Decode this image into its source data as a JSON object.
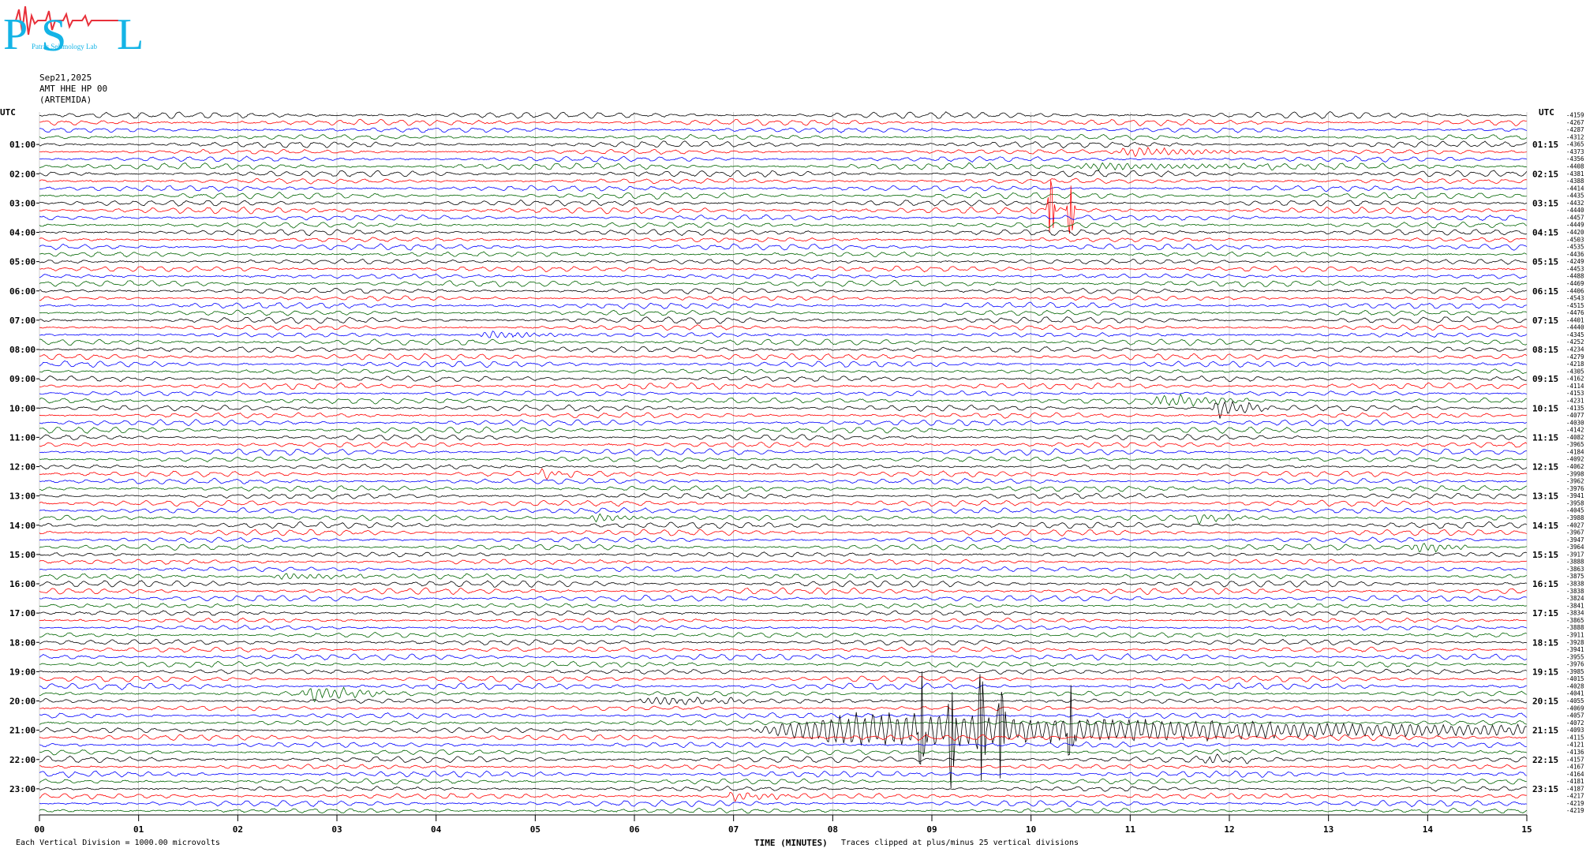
{
  "logo": {
    "text": "PSL",
    "subtitle": "Patras Seismology Lab",
    "colors": [
      "#14b4e6",
      "#e8303a"
    ]
  },
  "header": {
    "date": "Sep21,2025",
    "channel": "AMT HHE HP 00",
    "station": "(ARTEMIDA)"
  },
  "axis_labels": {
    "left_top": "UTC",
    "right_top": "UTC"
  },
  "footer": {
    "scale_text": "Each Vertical Division = 1000.00 microvolts",
    "xlabel": "TIME (MINUTES)",
    "clip_text": "Traces clipped at plus/minus 25 vertical divisions"
  },
  "chart_data": {
    "type": "line",
    "xlabel": "TIME (MINUTES)",
    "xlim": [
      0,
      15
    ],
    "x_ticks": [
      "00",
      "01",
      "02",
      "03",
      "04",
      "05",
      "06",
      "07",
      "08",
      "09",
      "10",
      "11",
      "12",
      "13",
      "14",
      "15"
    ],
    "left_hour_labels": [
      "01:00",
      "02:00",
      "03:00",
      "04:00",
      "05:00",
      "06:00",
      "07:00",
      "08:00",
      "09:00",
      "10:00",
      "11:00",
      "12:00",
      "13:00",
      "14:00",
      "15:00",
      "16:00",
      "17:00",
      "18:00",
      "19:00",
      "20:00",
      "21:00",
      "22:00",
      "23:00"
    ],
    "right_hour_labels": [
      "01:15",
      "02:15",
      "03:15",
      "04:15",
      "05:15",
      "06:15",
      "07:15",
      "08:15",
      "09:15",
      "10:15",
      "11:15",
      "12:15",
      "13:15",
      "14:15",
      "15:15",
      "16:15",
      "17:15",
      "18:15",
      "19:15",
      "20:15",
      "21:15",
      "22:15",
      "23:15"
    ],
    "trace_colors": [
      "#000000",
      "#ff0000",
      "#0000ff",
      "#006400"
    ],
    "traces_per_hour": 4,
    "trace_count": 96,
    "row_offsets": [
      -4159,
      -4267,
      -4287,
      -4312,
      -4365,
      -4373,
      -4356,
      -4408,
      -4381,
      -4388,
      -4414,
      -4435,
      -4432,
      -4440,
      -4457,
      -4449,
      -4420,
      -4503,
      -4535,
      -4436,
      -4249,
      -4453,
      -4488,
      -4469,
      -4406,
      -4543,
      -4515,
      -4476,
      -4401,
      -4440,
      -4345,
      -4252,
      -4234,
      -4279,
      -4218,
      -4305,
      -4162,
      -4114,
      -4153,
      -4231,
      -4135,
      -4077,
      -4030,
      -4142,
      -4082,
      -3965,
      -4184,
      -4092,
      -4062,
      -3998,
      -3962,
      -3976,
      -3941,
      -3958,
      -4045,
      -3988,
      -4027,
      -3967,
      -3947,
      -3964,
      -3917,
      -3888,
      -3863,
      -3875,
      -3838,
      -3838,
      -3824,
      -3841,
      -3834,
      -3865,
      -3888,
      -3911,
      -3928,
      -3941,
      -3955,
      -3976,
      -3985,
      -4015,
      -4028,
      -4041,
      -4055,
      -4069,
      -4057,
      -4072,
      -4093,
      -4115,
      -4121,
      -4136,
      -4157,
      -4167,
      -4164,
      -4181,
      -4187,
      -4217,
      -4219,
      -4219
    ],
    "events": [
      {
        "row": 5,
        "start_min": 10.8,
        "end_min": 12.2,
        "amp": 7
      },
      {
        "row": 30,
        "start_min": 4.4,
        "end_min": 5.3,
        "amp": 6
      },
      {
        "row": 7,
        "start_min": 10.3,
        "end_min": 12.8,
        "amp": 5
      },
      {
        "row": 39,
        "start_min": 11.2,
        "end_min": 12.2,
        "amp": 9
      },
      {
        "row": 40,
        "start_min": 11.8,
        "end_min": 12.4,
        "amp": 14
      },
      {
        "row": 49,
        "start_min": 5.0,
        "end_min": 5.4,
        "amp": 7
      },
      {
        "row": 55,
        "start_min": 5.5,
        "end_min": 6.2,
        "amp": 6
      },
      {
        "row": 55,
        "start_min": 11.6,
        "end_min": 12.2,
        "amp": 6
      },
      {
        "row": 59,
        "start_min": 13.8,
        "end_min": 14.4,
        "amp": 8
      },
      {
        "row": 63,
        "start_min": 2.3,
        "end_min": 3.4,
        "amp": 5
      },
      {
        "row": 79,
        "start_min": 2.6,
        "end_min": 3.5,
        "amp": 11
      },
      {
        "row": 80,
        "start_min": 6.0,
        "end_min": 7.2,
        "amp": 7
      },
      {
        "row": 84,
        "start_min": 7.1,
        "end_min": 15.0,
        "amp": 26
      },
      {
        "row": 88,
        "start_min": 11.7,
        "end_min": 12.3,
        "amp": 6
      },
      {
        "row": 93,
        "start_min": 6.9,
        "end_min": 7.6,
        "amp": 7
      }
    ],
    "spikes": [
      {
        "row": 84,
        "min": 8.9,
        "amp": 60
      },
      {
        "row": 84,
        "min": 9.2,
        "amp": 72
      },
      {
        "row": 84,
        "min": 9.5,
        "amp": 80
      },
      {
        "row": 84,
        "min": 9.7,
        "amp": 66
      },
      {
        "row": 84,
        "min": 10.4,
        "amp": 45
      },
      {
        "row": 13,
        "min": 10.2,
        "amp": 40
      },
      {
        "row": 13,
        "min": 10.4,
        "amp": 35
      }
    ]
  }
}
